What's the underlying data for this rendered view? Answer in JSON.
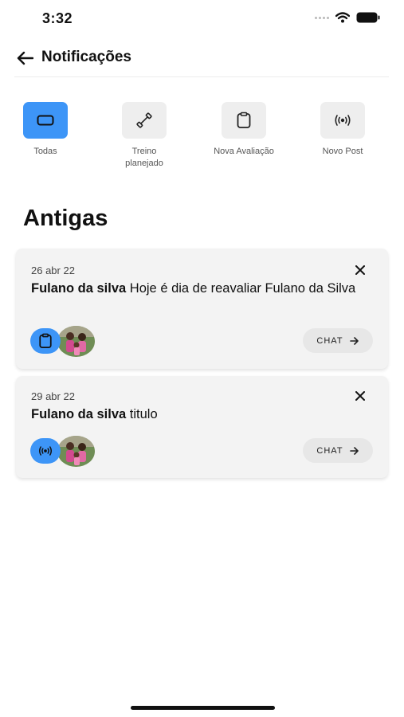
{
  "status_bar": {
    "time": "3:32"
  },
  "header": {
    "title": "Notificações"
  },
  "filters": [
    {
      "label": "Todas",
      "icon": "rectangle-icon",
      "active": true
    },
    {
      "label": "Treino planejado",
      "icon": "dumbbell-icon",
      "active": false
    },
    {
      "label": "Nova Avaliação",
      "icon": "clipboard-icon",
      "active": false
    },
    {
      "label": "Novo Post",
      "icon": "broadcast-icon",
      "active": false
    }
  ],
  "section": {
    "title": "Antigas"
  },
  "notifications": [
    {
      "date": "26 abr 22",
      "sender": "Fulano da silva",
      "message": "Hoje é dia de reavaliar Fulano da Silva",
      "type_icon": "clipboard-icon",
      "action_label": "CHAT"
    },
    {
      "date": "29 abr 22",
      "sender": "Fulano da silva",
      "message": "titulo",
      "type_icon": "broadcast-icon",
      "action_label": "CHAT"
    }
  ],
  "colors": {
    "accent": "#3d95f7",
    "card": "#f3f3f3",
    "chip": "#e7e7e7"
  }
}
